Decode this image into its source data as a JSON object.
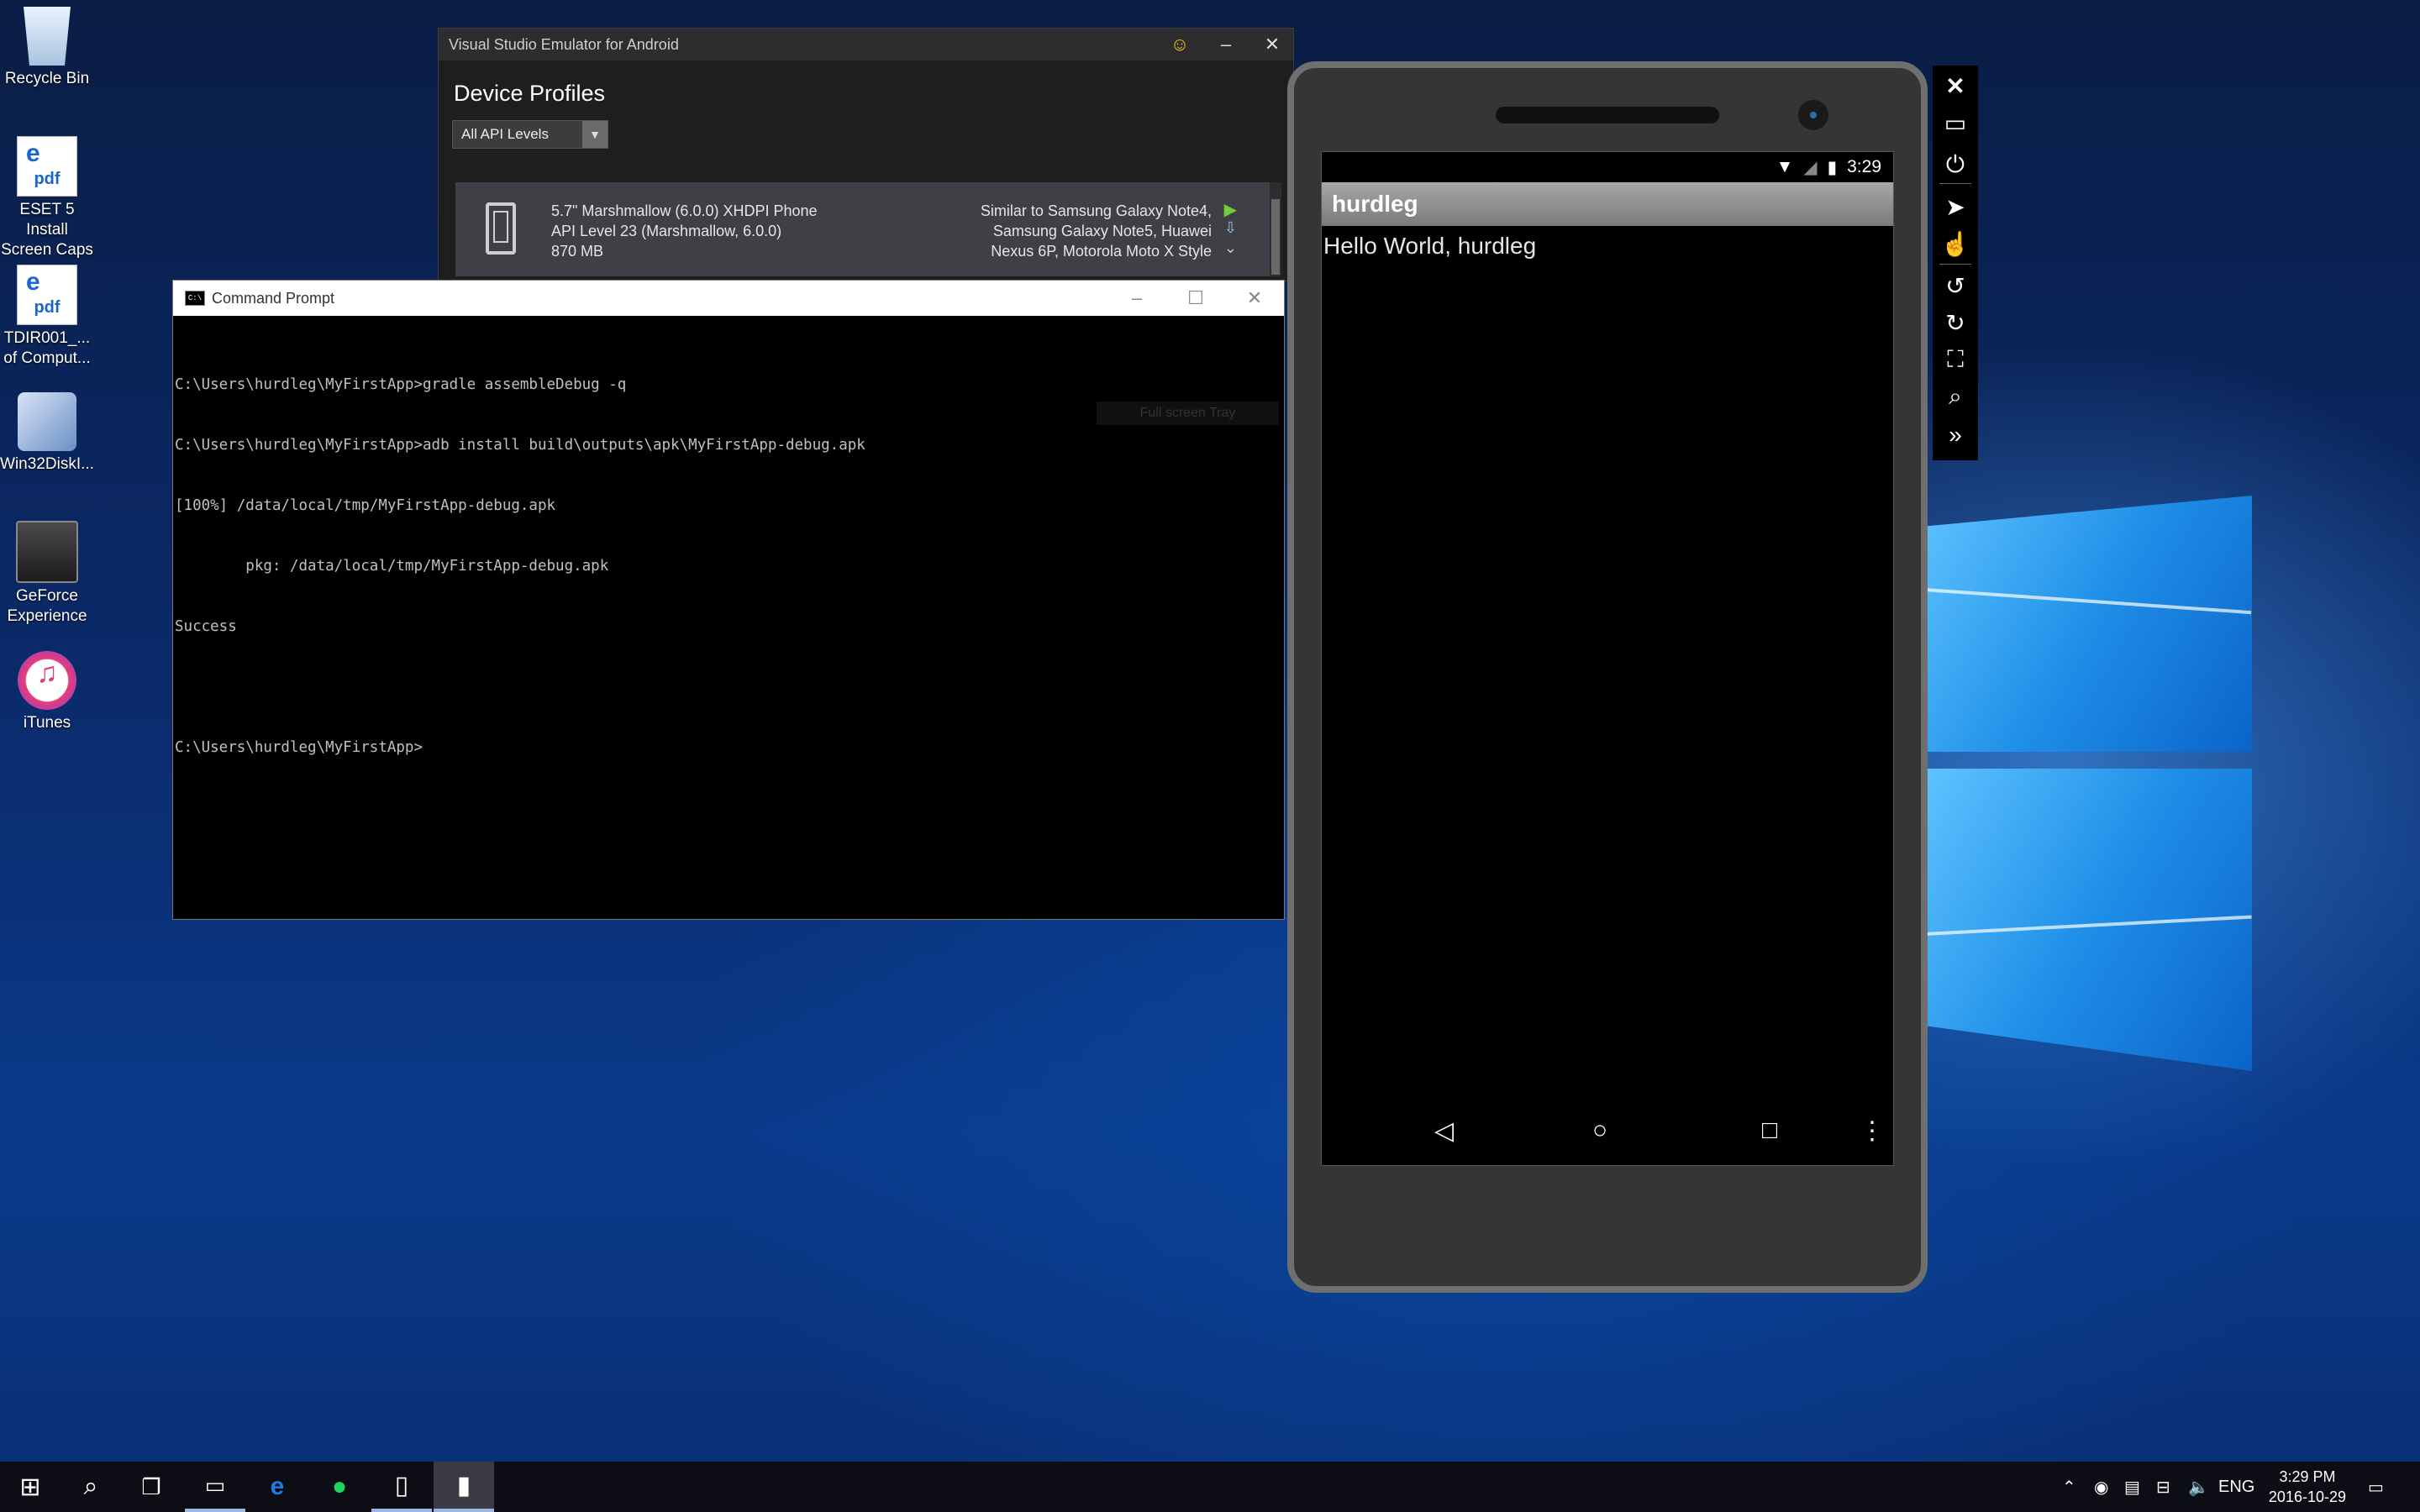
{
  "desktop": {
    "icons": [
      {
        "label": "Recycle Bin",
        "icon": "recycle-bin-icon"
      },
      {
        "label": "ESET 5 Install Screen Caps",
        "icon": "pdf-icon",
        "badge": "pdf"
      },
      {
        "label": "TDIR001_... of Comput...",
        "icon": "pdf-icon",
        "badge": "pdf"
      },
      {
        "label": "Win32DiskI...",
        "icon": "disk-imager-icon"
      },
      {
        "label": "GeForce Experience",
        "icon": "geforce-icon"
      },
      {
        "label": "iTunes",
        "icon": "itunes-icon"
      }
    ]
  },
  "vs_emulator": {
    "title": "Visual Studio Emulator for Android",
    "heading": "Device Profiles",
    "filter": "All API Levels",
    "profile": {
      "line1": "5.7\" Marshmallow (6.0.0) XHDPI Phone",
      "line2": "API Level 23 (Marshmallow, 6.0.0)",
      "line3": "870 MB",
      "similar1": "Similar to Samsung Galaxy Note4,",
      "similar2": "Samsung Galaxy Note5, Huawei",
      "similar3": "Nexus 6P, Motorola Moto X Style"
    }
  },
  "cmd": {
    "title": "Command Prompt",
    "icon_text": "C:\\",
    "lines": [
      "C:\\Users\\hurdleg\\MyFirstApp>gradle assembleDebug -q",
      "C:\\Users\\hurdleg\\MyFirstApp>adb install build\\outputs\\apk\\MyFirstApp-debug.apk",
      "[100%] /data/local/tmp/MyFirstApp-debug.apk",
      "        pkg: /data/local/tmp/MyFirstApp-debug.apk",
      "Success",
      "",
      "C:\\Users\\hurdleg\\MyFirstApp>"
    ],
    "tooltip": "Full screen Tray"
  },
  "phone": {
    "time": "3:29",
    "app_title": "hurdleg",
    "content": "Hello World, hurdleg"
  },
  "taskbar": {
    "tray_lang": "ENG",
    "time": "3:29 PM",
    "date": "2016-10-29"
  }
}
